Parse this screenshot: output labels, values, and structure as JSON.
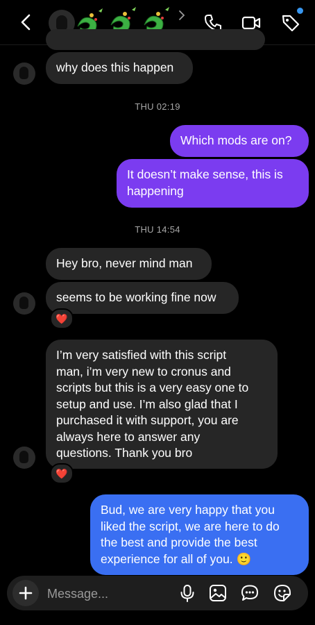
{
  "header": {
    "contact_avatar": "avatar",
    "icons": [
      "back-icon",
      "phone-icon",
      "video-icon",
      "tag-icon"
    ],
    "accent_dot": "#3897f0"
  },
  "thread": {
    "msg_partial": "",
    "msg_why": "why does this happen",
    "ts1": "THU 02:19",
    "sent_mods": "Which mods are on?",
    "sent_sense": "It doesn’t make sense, this is\nhappening",
    "ts2": "THU 14:54",
    "msg_heybro": "Hey bro, never mind man",
    "msg_working": "seems to be working fine now",
    "reaction1": "❤️",
    "msg_satisfied": "I’m very satisfied with this script\nman, i’m very new to cronus and\nscripts but this is a very easy one to\nsetup and use. I’m also glad that I\npurchased it with support, you are\nalways here to answer any\nquestions. Thank you bro",
    "reaction2": "❤️",
    "sent_bud": "Bud, we are very happy that you\nliked the script, we are here to do\nthe best and provide the best\nexperience for all of you. 🙂"
  },
  "composer": {
    "placeholder": "Message...",
    "icons": [
      "plus-icon",
      "microphone-icon",
      "image-icon",
      "chat-icon",
      "sticker-icon"
    ]
  },
  "colors": {
    "sent_purple": "#7b3cf0",
    "sent_blue": "#3a6ff2",
    "received": "#262626",
    "background": "#000000"
  }
}
